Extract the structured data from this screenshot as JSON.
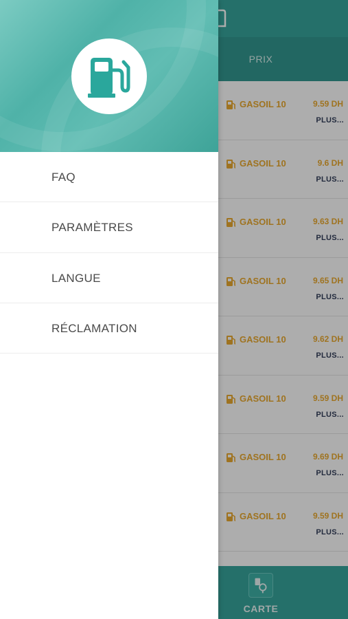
{
  "tabs": {
    "prix_label": "PRIX"
  },
  "price_list": [
    {
      "fuel": "GASOIL 10",
      "price": "9.59 DH",
      "more": "PLUS..."
    },
    {
      "fuel": "GASOIL 10",
      "price": "9.6 DH",
      "more": "PLUS..."
    },
    {
      "fuel": "GASOIL 10",
      "price": "9.63 DH",
      "more": "PLUS..."
    },
    {
      "fuel": "GASOIL 10",
      "price": "9.65 DH",
      "more": "PLUS..."
    },
    {
      "fuel": "GASOIL 10",
      "price": "9.62 DH",
      "more": "PLUS..."
    },
    {
      "fuel": "GASOIL 10",
      "price": "9.59 DH",
      "more": "PLUS..."
    },
    {
      "fuel": "GASOIL 10",
      "price": "9.69 DH",
      "more": "PLUS..."
    },
    {
      "fuel": "GASOIL 10",
      "price": "9.59 DH",
      "more": "PLUS..."
    }
  ],
  "bottom_nav": {
    "carte_label": "CARTE",
    "carte_icon": "map-pin-icon"
  },
  "drawer": {
    "header_icon": "fuel-pump-icon",
    "menu": [
      {
        "label": "FAQ"
      },
      {
        "label": "PARAMÈTRES"
      },
      {
        "label": "LANGUE"
      },
      {
        "label": "RÉCLAMATION"
      }
    ]
  },
  "colors": {
    "accent": "#259d93",
    "accent_dark": "#1f8f86",
    "price_orange": "#e8a21c",
    "link_navy": "#1e2a4a"
  }
}
